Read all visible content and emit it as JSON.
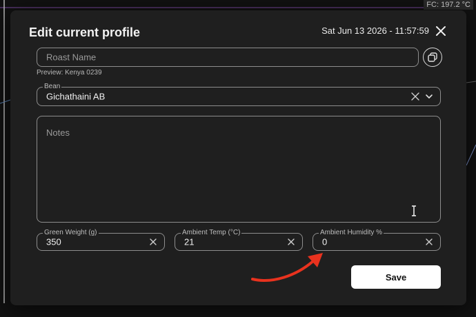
{
  "background": {
    "fc_readout": "FC: 197.2 °C"
  },
  "modal": {
    "title": "Edit current profile",
    "datetime": "Sat Jun 13 2026 - 11:57:59",
    "close_icon": "close-icon"
  },
  "roast_name": {
    "placeholder": "Roast Name",
    "value": "",
    "preview": "Preview: Kenya 0239"
  },
  "bean": {
    "label": "Bean",
    "value": "Gichathaini AB"
  },
  "notes": {
    "placeholder": "Notes",
    "value": ""
  },
  "green_weight": {
    "label": "Green Weight (g)",
    "value": "350"
  },
  "ambient_temp": {
    "label": "Ambient Temp (°C)",
    "value": "21"
  },
  "ambient_humidity": {
    "label": "Ambient Humidity %",
    "value": "0"
  },
  "actions": {
    "save_label": "Save"
  },
  "colors": {
    "modal_bg": "#1f1f1f",
    "page_bg": "#111111",
    "annotation_arrow": "#e8321e",
    "save_bg": "#ffffff"
  }
}
